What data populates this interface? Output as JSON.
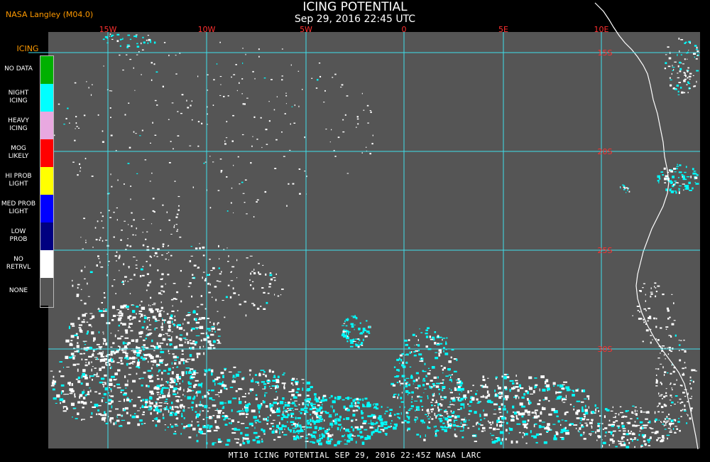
{
  "header": {
    "org": "NASA Langley (M04.0)",
    "title": "ICING POTENTIAL",
    "timestamp": "Sep 29, 2016 22:45 UTC"
  },
  "map": {
    "lon_labels": [
      "15W",
      "10W",
      "5W",
      "0",
      "5E",
      "10E"
    ],
    "lat_labels": [
      "15S",
      "20S",
      "25S",
      "30S"
    ],
    "grid_color": "#3ee0ea",
    "label_color": "#ff3030",
    "background_color": "#555555",
    "coast_color": "#ffffff"
  },
  "legend": {
    "title": "ICING",
    "items": [
      {
        "label": "NO DATA",
        "color": "#00b000"
      },
      {
        "label": "NIGHT ICING",
        "color": "#00ffff"
      },
      {
        "label": "HEAVY ICING",
        "color": "#e8a8e0"
      },
      {
        "label": "MOG LIKELY",
        "color": "#ff0000"
      },
      {
        "label": "HI PROB LIGHT",
        "color": "#ffff00"
      },
      {
        "label": "MED PROB LIGHT",
        "color": "#0000ff"
      },
      {
        "label": "LOW PROB",
        "color": "#000080"
      },
      {
        "label": "NO RETRVL",
        "color": "#ffffff"
      },
      {
        "label": "NONE",
        "color": "#555555"
      }
    ]
  },
  "footer": {
    "text": "MT10  ICING POTENTIAL  SEP 29, 2016 22:45Z  NASA LARC"
  }
}
